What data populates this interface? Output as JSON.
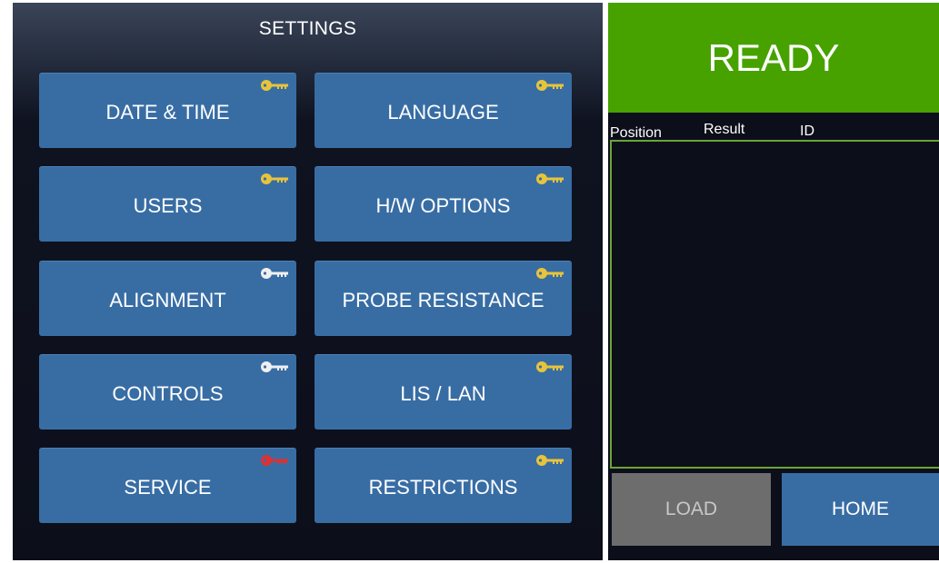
{
  "settings": {
    "title": "SETTINGS",
    "buttons": [
      {
        "label": "DATE & TIME",
        "key_color": "#e8c43a",
        "key_icon": "key-icon"
      },
      {
        "label": "LANGUAGE",
        "key_color": "#e8c43a",
        "key_icon": "key-icon"
      },
      {
        "label": "USERS",
        "key_color": "#e8c43a",
        "key_icon": "key-icon"
      },
      {
        "label": "H/W OPTIONS",
        "key_color": "#e8c43a",
        "key_icon": "key-icon"
      },
      {
        "label": "ALIGNMENT",
        "key_color": "#f0f0f0",
        "key_icon": "key-icon"
      },
      {
        "label": "PROBE RESISTANCE",
        "key_color": "#e8c43a",
        "key_icon": "key-icon"
      },
      {
        "label": "CONTROLS",
        "key_color": "#f0f0f0",
        "key_icon": "key-icon"
      },
      {
        "label": "LIS / LAN",
        "key_color": "#e8c43a",
        "key_icon": "key-icon"
      },
      {
        "label": "SERVICE",
        "key_color": "#e03030",
        "key_icon": "key-icon"
      },
      {
        "label": "RESTRICTIONS",
        "key_color": "#e8c43a",
        "key_icon": "key-icon"
      }
    ]
  },
  "status": {
    "text": "READY",
    "color": "#47a200"
  },
  "results": {
    "columns": [
      "Position",
      "Result",
      "ID"
    ],
    "rows": []
  },
  "actions": {
    "load_label": "LOAD",
    "home_label": "HOME"
  },
  "colors": {
    "button_blue": "#386da4",
    "disabled_gray": "#6d6d6d",
    "panel_dark": "#0c0f1a",
    "results_border": "#6aa438"
  }
}
